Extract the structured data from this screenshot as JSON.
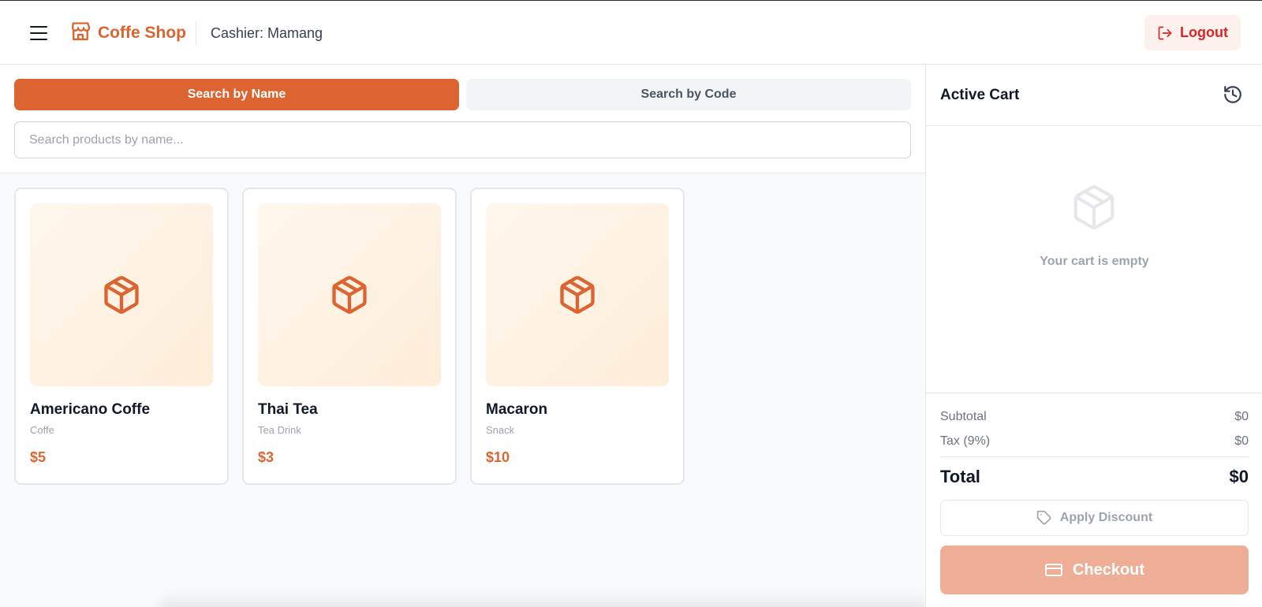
{
  "header": {
    "brand_name": "Coffe Shop",
    "cashier": "Cashier: Mamang",
    "logout_label": "Logout"
  },
  "search": {
    "tabs": [
      {
        "label": "Search by Name",
        "active": true
      },
      {
        "label": "Search by Code",
        "active": false
      }
    ],
    "placeholder": "Search products by name...",
    "value": ""
  },
  "products": [
    {
      "name": "Americano Coffe",
      "category": "Coffe",
      "price": "$5",
      "icon": "package-icon"
    },
    {
      "name": "Thai Tea",
      "category": "Tea Drink",
      "price": "$3",
      "icon": "package-icon"
    },
    {
      "name": "Macaron",
      "category": "Snack",
      "price": "$10",
      "icon": "package-icon"
    }
  ],
  "cart": {
    "title": "Active Cart",
    "empty_text": "Your cart is empty",
    "subtotal_label": "Subtotal",
    "subtotal_value": "$0",
    "tax_label": "Tax (9%)",
    "tax_value": "$0",
    "total_label": "Total",
    "total_value": "$0",
    "discount_label": "Apply Discount",
    "checkout_label": "Checkout"
  },
  "colors": {
    "accent": "#dc6430",
    "logout_text": "#dc2626",
    "checkout_disabled": "#eeae96"
  },
  "icons": [
    "menu-icon",
    "store-icon",
    "logout-icon",
    "package-icon",
    "history-icon",
    "tag-icon",
    "credit-card-icon"
  ]
}
